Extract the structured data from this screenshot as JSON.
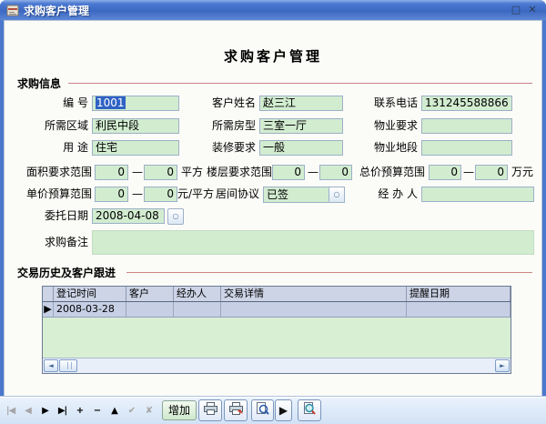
{
  "window": {
    "title": "求购客户管理",
    "maximize_glyph": "□",
    "close_glyph": "✕"
  },
  "page": {
    "title": "求购客户管理"
  },
  "sections": {
    "info": "求购信息",
    "history": "交易历史及客户跟进"
  },
  "range_dash": "—",
  "fields": {
    "code": {
      "label": "编 号",
      "value": "1001"
    },
    "customer_name": {
      "label": "客户姓名",
      "value": "赵三江"
    },
    "phone": {
      "label": "联系电话",
      "value": "131245588866"
    },
    "region": {
      "label": "所需区域",
      "value": "利民中段"
    },
    "house_type": {
      "label": "所需房型",
      "value": "三室一厅"
    },
    "property_req": {
      "label": "物业要求",
      "value": ""
    },
    "usage": {
      "label": "用 途",
      "value": "住宅"
    },
    "decoration": {
      "label": "装修要求",
      "value": "一般"
    },
    "property_location": {
      "label": "物业地段",
      "value": ""
    },
    "area_range": {
      "label": "面积要求范围",
      "from": "0",
      "to": "0",
      "unit": "平方"
    },
    "floor_range": {
      "label": "楼层要求范围",
      "from": "0",
      "to": "0",
      "unit": ""
    },
    "total_price_range": {
      "label": "总价预算范围",
      "from": "0",
      "to": "0",
      "unit": "万元"
    },
    "unit_price_range": {
      "label": "单价预算范围",
      "from": "0",
      "to": "0",
      "unit": "元/平方"
    },
    "agreement": {
      "label": "居间协议",
      "value": "已签"
    },
    "operator": {
      "label": "经 办 人",
      "value": ""
    },
    "entrust_date": {
      "label": "委托日期",
      "value": "2008-04-08"
    },
    "remark": {
      "label": "求购备注",
      "value": ""
    }
  },
  "table": {
    "columns": [
      "登记时间",
      "客户",
      "经办人",
      "交易详情",
      "提醒日期"
    ],
    "row_indicator": "▶",
    "rows": [
      {
        "cells": [
          "2008-03-28",
          "",
          "",
          "",
          ""
        ]
      }
    ]
  },
  "icons": {
    "dropdown": "○",
    "scroll_left": "◄",
    "scroll_right": "►"
  },
  "toolbar": {
    "add_label": "增加",
    "play_glyph": "▶",
    "navigator": [
      {
        "name": "first",
        "glyph": "|◀"
      },
      {
        "name": "prior",
        "glyph": "◀"
      },
      {
        "name": "next",
        "glyph": "▶"
      },
      {
        "name": "last",
        "glyph": "▶|"
      },
      {
        "name": "insert",
        "glyph": "+"
      },
      {
        "name": "delete",
        "glyph": "−"
      },
      {
        "name": "edit",
        "glyph": "▲"
      },
      {
        "name": "post",
        "glyph": "✔"
      },
      {
        "name": "cancel",
        "glyph": "✘"
      }
    ]
  }
}
